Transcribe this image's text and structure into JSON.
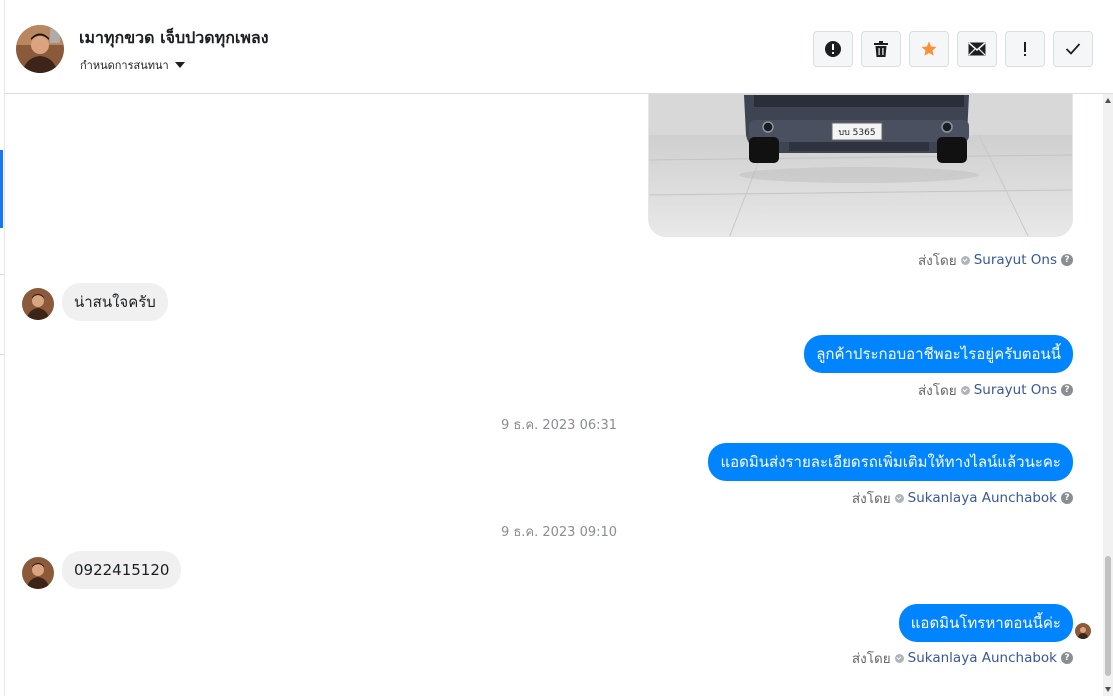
{
  "header": {
    "title": "เมาทุกขวด เจ็บปวดทุกเพลง",
    "subtitle": "กำหนดการสนทนา"
  },
  "actions": [
    {
      "name": "report-button",
      "icon": "alert-circle-icon"
    },
    {
      "name": "delete-button",
      "icon": "trash-icon"
    },
    {
      "name": "star-button",
      "icon": "star-icon",
      "color": "#f7923b"
    },
    {
      "name": "mark-unread-button",
      "icon": "envelope-icon"
    },
    {
      "name": "important-button",
      "icon": "exclamation-icon"
    },
    {
      "name": "done-button",
      "icon": "checkmark-icon"
    }
  ],
  "photo": {
    "plate_text": "บบ 5365"
  },
  "messages": [
    {
      "sent_by_label": "ส่งโดย",
      "sender": "Surayut Ons"
    },
    {
      "text": "น่าสนใจครับ"
    },
    {
      "text": "ลูกค้าประกอบอาชีพอะไรอยู่ครับตอนนี้",
      "sent_by_label": "ส่งโดย",
      "sender": "Surayut Ons"
    },
    {
      "timestamp": "9 ธ.ค. 2023 06:31"
    },
    {
      "text": "แอดมินส่งรายละเอียดรถเพิ่มเติมให้ทางไลน์แล้วนะคะ",
      "sent_by_label": "ส่งโดย",
      "sender": "Sukanlaya Aunchabok"
    },
    {
      "timestamp": "9 ธ.ค. 2023 09:10"
    },
    {
      "text": "0922415120"
    },
    {
      "text": "แอดมินโทรหาตอนนี้ค่ะ",
      "sent_by_label": "ส่งโดย",
      "sender": "Sukanlaya Aunchabok"
    }
  ],
  "colors": {
    "outgoing_bubble": "#0084ff",
    "incoming_bubble": "#f0f0f0",
    "sender_name": "#385898",
    "accent": "#1877f2"
  }
}
